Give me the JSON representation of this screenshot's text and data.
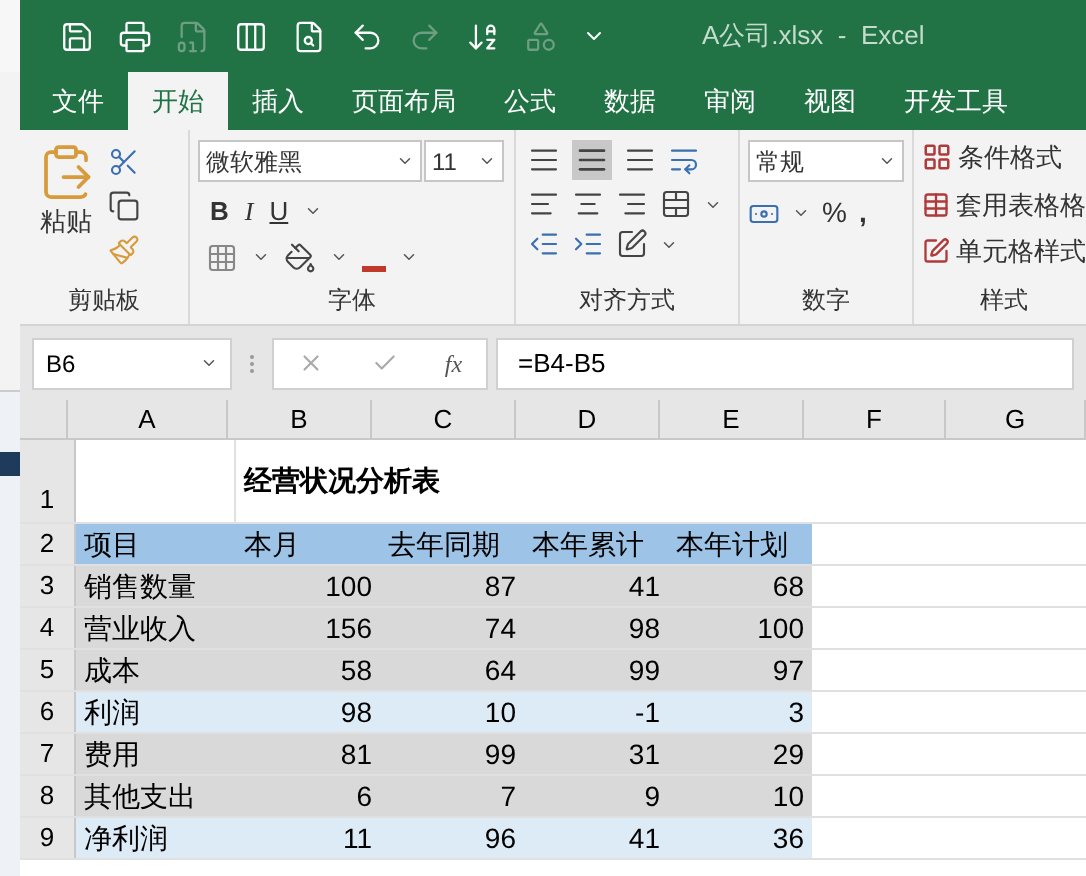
{
  "title_bar": {
    "title": "A公司.xlsx  -  Excel"
  },
  "tabs": [
    {
      "label": "文件",
      "selected": false
    },
    {
      "label": "开始",
      "selected": true
    },
    {
      "label": "插入",
      "selected": false
    },
    {
      "label": "页面布局",
      "selected": false
    },
    {
      "label": "公式",
      "selected": false
    },
    {
      "label": "数据",
      "selected": false
    },
    {
      "label": "审阅",
      "selected": false
    },
    {
      "label": "视图",
      "selected": false
    },
    {
      "label": "开发工具",
      "selected": false
    }
  ],
  "ribbon": {
    "clipboard": {
      "paste": "粘贴",
      "label": "剪贴板"
    },
    "font": {
      "name": "微软雅黑",
      "size": "11",
      "bold": "B",
      "italic": "I",
      "underline": "U",
      "label": "字体"
    },
    "alignment": {
      "label": "对齐方式"
    },
    "number": {
      "format": "常规",
      "percent": "%",
      "comma": ",",
      "label": "数字"
    },
    "styles": {
      "items": [
        "条件格式",
        "套用表格格",
        "单元格样式"
      ],
      "label": "样式"
    }
  },
  "formula_bar": {
    "name_box": "B6",
    "function_label": "fx",
    "formula": "=B4-B5"
  },
  "sheet": {
    "columns": [
      "A",
      "B",
      "C",
      "D",
      "E",
      "F",
      "G"
    ],
    "title_row": {
      "number": "1",
      "title": "经营状况分析表"
    },
    "header_row": {
      "number": "2",
      "cells": [
        "项目",
        "本月",
        "去年同期",
        "本年累计",
        "本年计划"
      ]
    },
    "rows": [
      {
        "number": "3",
        "kind": "gray",
        "cells": [
          "销售数量",
          "100",
          "87",
          "41",
          "68"
        ]
      },
      {
        "number": "4",
        "kind": "gray",
        "cells": [
          "营业收入",
          "156",
          "74",
          "98",
          "100"
        ]
      },
      {
        "number": "5",
        "kind": "gray",
        "cells": [
          "成本",
          "58",
          "64",
          "99",
          "97"
        ]
      },
      {
        "number": "6",
        "kind": "blue",
        "cells": [
          "利润",
          "98",
          "10",
          "-1",
          "3"
        ]
      },
      {
        "number": "7",
        "kind": "gray",
        "cells": [
          "费用",
          "81",
          "99",
          "31",
          "29"
        ]
      },
      {
        "number": "8",
        "kind": "gray",
        "cells": [
          "其他支出",
          "6",
          "7",
          "9",
          "10"
        ]
      },
      {
        "number": "9",
        "kind": "blue",
        "cells": [
          "净利润",
          "11",
          "96",
          "41",
          "36"
        ]
      }
    ]
  }
}
